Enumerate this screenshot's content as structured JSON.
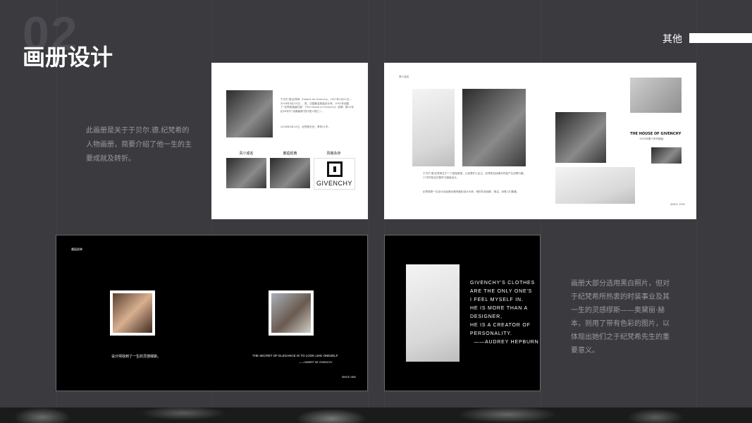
{
  "header": {
    "number": "02",
    "title": "画册设计",
    "section_label": "其他"
  },
  "descriptions": {
    "left": "此画册是关于于贝尔.德.纪梵希的人物画册，简要介绍了他一生的主要成就及转折。",
    "right": "画册大部分选用黑白照片，但对于纪梵希所热衷的时装事业及其一生的灵感缪斯——奥黛丽·赫本，则用了带有色彩的图片，以体现出她们之于纪梵希先生的重要意义。"
  },
  "page1": {
    "bio_text": "于贝尔·德·纪梵希（Hubert de Givenchy，1927年2月21日—2018年3月10日），男，法国著名服装设计师。1952年创建了“纪梵希高级时装”（The House of Givenchy）品牌，是20世纪50年代“优雅格调”的代表人物之一。",
    "bio_text2": "2018年3月10日，纪梵希去世，享年91岁。",
    "captions": [
      "青少成名",
      "邂逅经典",
      "风格永存"
    ],
    "logo_text": "GIVENCHY"
  },
  "page2": {
    "top_label": "青少成名",
    "body_text": "于贝尔·德·纪梵希生于一个富裕家庭，父亲是矿山业主。纪梵希自幼便对时装产生浓厚兴趣，17岁时前往巴黎学习服装设计。",
    "body_text2": "纪梵希是一位设计出经典优雅风格的设计大师，他的作品纯粹、简洁，深受人们喜爱。",
    "house_title": "THE HOUSE OF GIVENCHY",
    "house_sub": "1952年第个系列服装",
    "footer": "SINCE 1952"
  },
  "page3": {
    "top_label": "邂逅经典",
    "caption_left": "设计师找到了一生的灵感缪斯。",
    "caption_right": "THE SECRET OF ELEGANCE IS TO LOOK LIKE ONESELF.",
    "caption_right_sub": "——HUBERT DE GIVENCHY",
    "footer": "SINCE 1952"
  },
  "page4": {
    "quote": "GIVENCHY'S CLOTHES\nARE THE ONLY ONE'S\nI FEEL MYSELF IN.\nHE IS MORE THAN A\nDESIGNER,\nHE IS A CREATOR OF\nPERSONALITY.\n  ——AUDREY HEPBURN"
  }
}
